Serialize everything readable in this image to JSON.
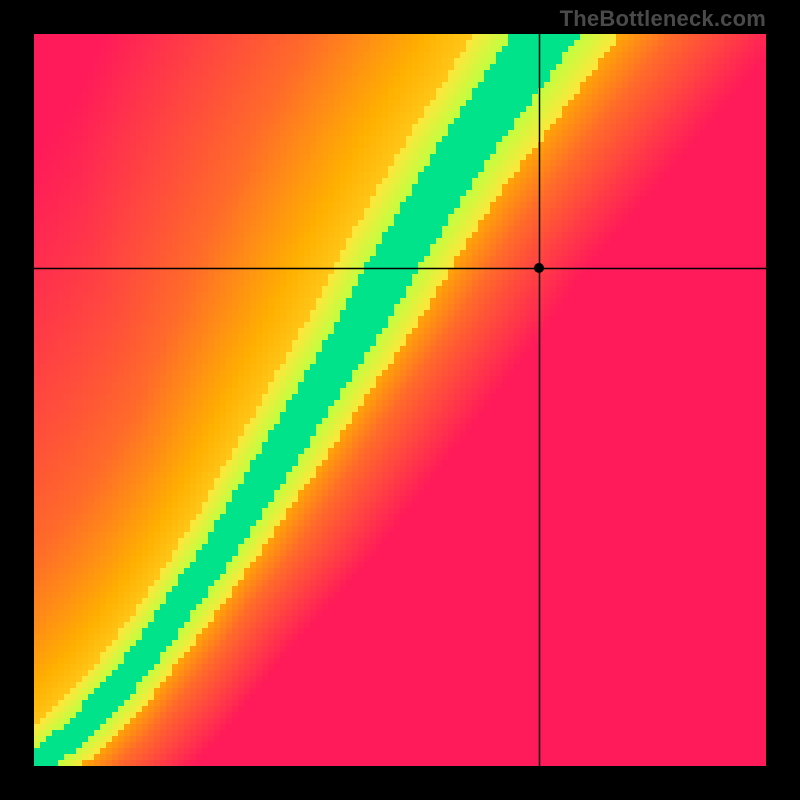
{
  "watermark": "TheBottleneck.com",
  "chart_data": {
    "type": "heatmap",
    "title": "",
    "xlabel": "",
    "ylabel": "",
    "xlim": [
      0,
      1
    ],
    "ylim": [
      0,
      1
    ],
    "grid": false,
    "legend": false,
    "crosshair": {
      "x": 0.69,
      "y": 0.68
    },
    "marker": {
      "x": 0.69,
      "y": 0.68
    },
    "optimal_curve": [
      {
        "x": 0.0,
        "y": 0.0
      },
      {
        "x": 0.05,
        "y": 0.04
      },
      {
        "x": 0.1,
        "y": 0.09
      },
      {
        "x": 0.15,
        "y": 0.15
      },
      {
        "x": 0.2,
        "y": 0.22
      },
      {
        "x": 0.25,
        "y": 0.29
      },
      {
        "x": 0.3,
        "y": 0.37
      },
      {
        "x": 0.35,
        "y": 0.45
      },
      {
        "x": 0.4,
        "y": 0.53
      },
      {
        "x": 0.45,
        "y": 0.61
      },
      {
        "x": 0.5,
        "y": 0.7
      },
      {
        "x": 0.55,
        "y": 0.78
      },
      {
        "x": 0.6,
        "y": 0.86
      },
      {
        "x": 0.65,
        "y": 0.93
      },
      {
        "x": 0.7,
        "y": 1.0
      }
    ],
    "colormap": [
      {
        "stop": 0.0,
        "color": "#ff1a5a"
      },
      {
        "stop": 0.35,
        "color": "#ff6a2a"
      },
      {
        "stop": 0.55,
        "color": "#ffb000"
      },
      {
        "stop": 0.75,
        "color": "#ffe63a"
      },
      {
        "stop": 0.9,
        "color": "#bfff40"
      },
      {
        "stop": 1.0,
        "color": "#00e38a"
      }
    ],
    "value_description": "heat value = 1 - normalized distance from optimal curve; green ridge indicates balanced pairing, red indicates severe bottleneck"
  }
}
